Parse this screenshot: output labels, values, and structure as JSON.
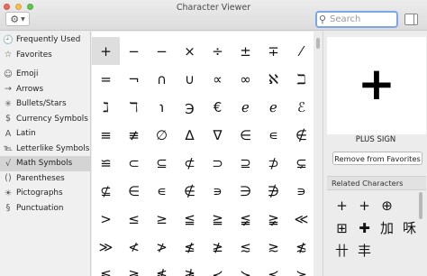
{
  "window": {
    "title": "Character Viewer"
  },
  "toolbar": {
    "action_icon": "gear-icon"
  },
  "search": {
    "placeholder": "Search",
    "value": ""
  },
  "sidebar": {
    "items": [
      {
        "icon": "clock-icon",
        "glyph": "🕘",
        "label": "Frequently Used",
        "selected": false
      },
      {
        "icon": "star-icon",
        "glyph": "☆",
        "label": "Favorites",
        "selected": false
      },
      {
        "icon": "smiley-icon",
        "glyph": "☺",
        "label": "Emoji",
        "selected": false
      },
      {
        "icon": "arrow-icon",
        "glyph": "→",
        "label": "Arrows",
        "selected": false
      },
      {
        "icon": "asterisk-icon",
        "glyph": "✳",
        "label": "Bullets/Stars",
        "selected": false
      },
      {
        "icon": "currency-icon",
        "glyph": "$",
        "label": "Currency Symbols",
        "selected": false
      },
      {
        "icon": "latin-icon",
        "glyph": "A",
        "label": "Latin",
        "selected": false
      },
      {
        "icon": "letterlike-icon",
        "glyph": "℡",
        "label": "Letterlike Symbols",
        "selected": false
      },
      {
        "icon": "sqrt-icon",
        "glyph": "√",
        "label": "Math Symbols",
        "selected": true
      },
      {
        "icon": "parentheses-icon",
        "glyph": "()",
        "label": "Parentheses",
        "selected": false
      },
      {
        "icon": "pictograph-icon",
        "glyph": "☀",
        "label": "Pictographs",
        "selected": false
      },
      {
        "icon": "punctuation-icon",
        "glyph": "§",
        "label": "Punctuation",
        "selected": false
      }
    ]
  },
  "grid": {
    "selected_index": 0,
    "characters": [
      "+",
      "−",
      "−",
      "×",
      "÷",
      "±",
      "∓",
      "⁄",
      "=",
      "¬",
      "∩",
      "∪",
      "∝",
      "∞",
      "ℵ",
      "ℶ",
      "ℷ",
      "ℸ",
      "℩",
      "℈",
      "€",
      "ℯ",
      "ℯ",
      "ℰ",
      "≡",
      "≢",
      "∅",
      "∆",
      "∇",
      "∈",
      "∊",
      "∉",
      "≌",
      "⊂",
      "⊆",
      "⊄",
      "⊃",
      "⊇",
      "⊅",
      "⊊",
      "⊈",
      "∈",
      "∊",
      "∉",
      "∍",
      "∋",
      "∌",
      "∍",
      ">",
      "≤",
      "≥",
      "≦",
      "≧",
      "≨",
      "≩",
      "≪",
      "≫",
      "≮",
      "≯",
      "≰",
      "≱",
      "≲",
      "≳",
      "≴",
      "≶",
      "≷",
      "≸",
      "≹",
      "≺",
      "≻",
      "≼",
      "≽"
    ]
  },
  "detail": {
    "preview": "+",
    "name": "PLUS SIGN",
    "favorites_button": "Remove from Favorites",
    "related_title": "Related Characters",
    "related": [
      "+",
      "+",
      "⊕",
      "",
      "⊞",
      "✚",
      "加",
      "咊",
      "卄",
      "丰",
      "",
      ""
    ]
  }
}
